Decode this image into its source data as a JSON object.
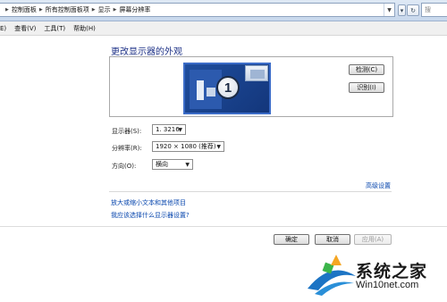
{
  "address_bar": {
    "crumbs": [
      "控制面板",
      "所有控制面板项",
      "显示",
      "屏幕分辨率"
    ],
    "refresh_icon": "refresh-icon",
    "search_placeholder": "搜"
  },
  "menu": [
    "E)",
    "查看(V)",
    "工具(T)",
    "帮助(H)"
  ],
  "main": {
    "title": "更改显示器的外观",
    "monitor_number": "1",
    "detect_button": "检测(C)",
    "identify_button": "识别(I)"
  },
  "fields": {
    "display": {
      "label": "显示器(S):",
      "value": "1. 3216"
    },
    "resolution": {
      "label": "分辨率(R):",
      "value": "1920 × 1080 (推荐)"
    },
    "orientation": {
      "label": "方向(O):",
      "value": "横向"
    }
  },
  "advanced_link": "高级设置",
  "links": [
    "放大或缩小文本和其他项目",
    "我应该选择什么显示器设置?"
  ],
  "footer": {
    "ok": "确定",
    "cancel": "取消",
    "apply": "应用(A)"
  },
  "watermark": {
    "name": "系统之家",
    "url": "Win10net.com"
  }
}
